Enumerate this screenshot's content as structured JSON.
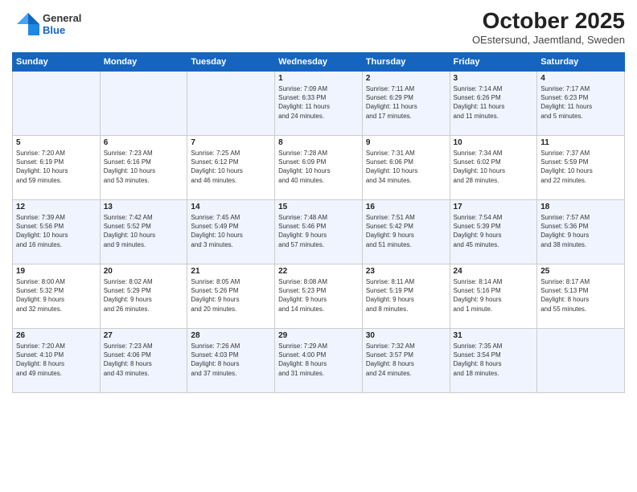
{
  "header": {
    "logo_general": "General",
    "logo_blue": "Blue",
    "month": "October 2025",
    "location": "OEstersund, Jaemtland, Sweden"
  },
  "weekdays": [
    "Sunday",
    "Monday",
    "Tuesday",
    "Wednesday",
    "Thursday",
    "Friday",
    "Saturday"
  ],
  "weeks": [
    [
      {
        "day": "",
        "text": ""
      },
      {
        "day": "",
        "text": ""
      },
      {
        "day": "",
        "text": ""
      },
      {
        "day": "1",
        "text": "Sunrise: 7:09 AM\nSunset: 6:33 PM\nDaylight: 11 hours\nand 24 minutes."
      },
      {
        "day": "2",
        "text": "Sunrise: 7:11 AM\nSunset: 6:29 PM\nDaylight: 11 hours\nand 17 minutes."
      },
      {
        "day": "3",
        "text": "Sunrise: 7:14 AM\nSunset: 6:26 PM\nDaylight: 11 hours\nand 11 minutes."
      },
      {
        "day": "4",
        "text": "Sunrise: 7:17 AM\nSunset: 6:23 PM\nDaylight: 11 hours\nand 5 minutes."
      }
    ],
    [
      {
        "day": "5",
        "text": "Sunrise: 7:20 AM\nSunset: 6:19 PM\nDaylight: 10 hours\nand 59 minutes."
      },
      {
        "day": "6",
        "text": "Sunrise: 7:23 AM\nSunset: 6:16 PM\nDaylight: 10 hours\nand 53 minutes."
      },
      {
        "day": "7",
        "text": "Sunrise: 7:25 AM\nSunset: 6:12 PM\nDaylight: 10 hours\nand 46 minutes."
      },
      {
        "day": "8",
        "text": "Sunrise: 7:28 AM\nSunset: 6:09 PM\nDaylight: 10 hours\nand 40 minutes."
      },
      {
        "day": "9",
        "text": "Sunrise: 7:31 AM\nSunset: 6:06 PM\nDaylight: 10 hours\nand 34 minutes."
      },
      {
        "day": "10",
        "text": "Sunrise: 7:34 AM\nSunset: 6:02 PM\nDaylight: 10 hours\nand 28 minutes."
      },
      {
        "day": "11",
        "text": "Sunrise: 7:37 AM\nSunset: 5:59 PM\nDaylight: 10 hours\nand 22 minutes."
      }
    ],
    [
      {
        "day": "12",
        "text": "Sunrise: 7:39 AM\nSunset: 5:56 PM\nDaylight: 10 hours\nand 16 minutes."
      },
      {
        "day": "13",
        "text": "Sunrise: 7:42 AM\nSunset: 5:52 PM\nDaylight: 10 hours\nand 9 minutes."
      },
      {
        "day": "14",
        "text": "Sunrise: 7:45 AM\nSunset: 5:49 PM\nDaylight: 10 hours\nand 3 minutes."
      },
      {
        "day": "15",
        "text": "Sunrise: 7:48 AM\nSunset: 5:46 PM\nDaylight: 9 hours\nand 57 minutes."
      },
      {
        "day": "16",
        "text": "Sunrise: 7:51 AM\nSunset: 5:42 PM\nDaylight: 9 hours\nand 51 minutes."
      },
      {
        "day": "17",
        "text": "Sunrise: 7:54 AM\nSunset: 5:39 PM\nDaylight: 9 hours\nand 45 minutes."
      },
      {
        "day": "18",
        "text": "Sunrise: 7:57 AM\nSunset: 5:36 PM\nDaylight: 9 hours\nand 38 minutes."
      }
    ],
    [
      {
        "day": "19",
        "text": "Sunrise: 8:00 AM\nSunset: 5:32 PM\nDaylight: 9 hours\nand 32 minutes."
      },
      {
        "day": "20",
        "text": "Sunrise: 8:02 AM\nSunset: 5:29 PM\nDaylight: 9 hours\nand 26 minutes."
      },
      {
        "day": "21",
        "text": "Sunrise: 8:05 AM\nSunset: 5:26 PM\nDaylight: 9 hours\nand 20 minutes."
      },
      {
        "day": "22",
        "text": "Sunrise: 8:08 AM\nSunset: 5:23 PM\nDaylight: 9 hours\nand 14 minutes."
      },
      {
        "day": "23",
        "text": "Sunrise: 8:11 AM\nSunset: 5:19 PM\nDaylight: 9 hours\nand 8 minutes."
      },
      {
        "day": "24",
        "text": "Sunrise: 8:14 AM\nSunset: 5:16 PM\nDaylight: 9 hours\nand 1 minute."
      },
      {
        "day": "25",
        "text": "Sunrise: 8:17 AM\nSunset: 5:13 PM\nDaylight: 8 hours\nand 55 minutes."
      }
    ],
    [
      {
        "day": "26",
        "text": "Sunrise: 7:20 AM\nSunset: 4:10 PM\nDaylight: 8 hours\nand 49 minutes."
      },
      {
        "day": "27",
        "text": "Sunrise: 7:23 AM\nSunset: 4:06 PM\nDaylight: 8 hours\nand 43 minutes."
      },
      {
        "day": "28",
        "text": "Sunrise: 7:26 AM\nSunset: 4:03 PM\nDaylight: 8 hours\nand 37 minutes."
      },
      {
        "day": "29",
        "text": "Sunrise: 7:29 AM\nSunset: 4:00 PM\nDaylight: 8 hours\nand 31 minutes."
      },
      {
        "day": "30",
        "text": "Sunrise: 7:32 AM\nSunset: 3:57 PM\nDaylight: 8 hours\nand 24 minutes."
      },
      {
        "day": "31",
        "text": "Sunrise: 7:35 AM\nSunset: 3:54 PM\nDaylight: 8 hours\nand 18 minutes."
      },
      {
        "day": "",
        "text": ""
      }
    ]
  ]
}
